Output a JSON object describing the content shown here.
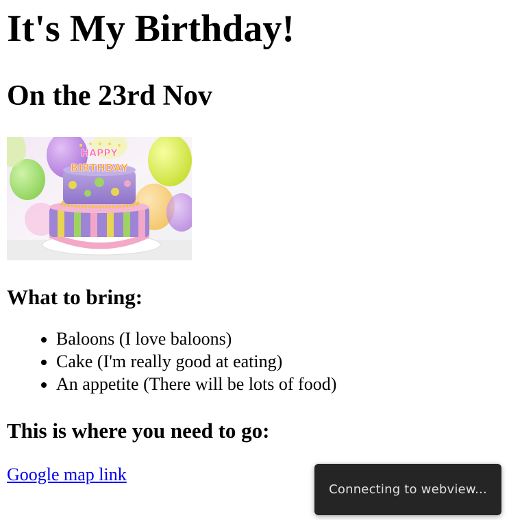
{
  "page": {
    "title": "It's My Birthday!",
    "date_heading": "On the 23rd Nov",
    "bring_heading": "What to bring:",
    "bring_items": [
      "Baloons (I love baloons)",
      "Cake (I'm really good at eating)",
      "An appetite (There will be lots of food)"
    ],
    "where_heading": "This is where you need to go:",
    "map_link_label": "Google map link"
  },
  "image": {
    "cake_letters_top": "HAPPY",
    "cake_letters_bottom": "BIRTHDAY"
  },
  "toast": {
    "message": "Connecting to webview..."
  },
  "colors": {
    "link": "#0000ee",
    "toast_bg": "#252525",
    "toast_text": "#e0e0e0"
  }
}
